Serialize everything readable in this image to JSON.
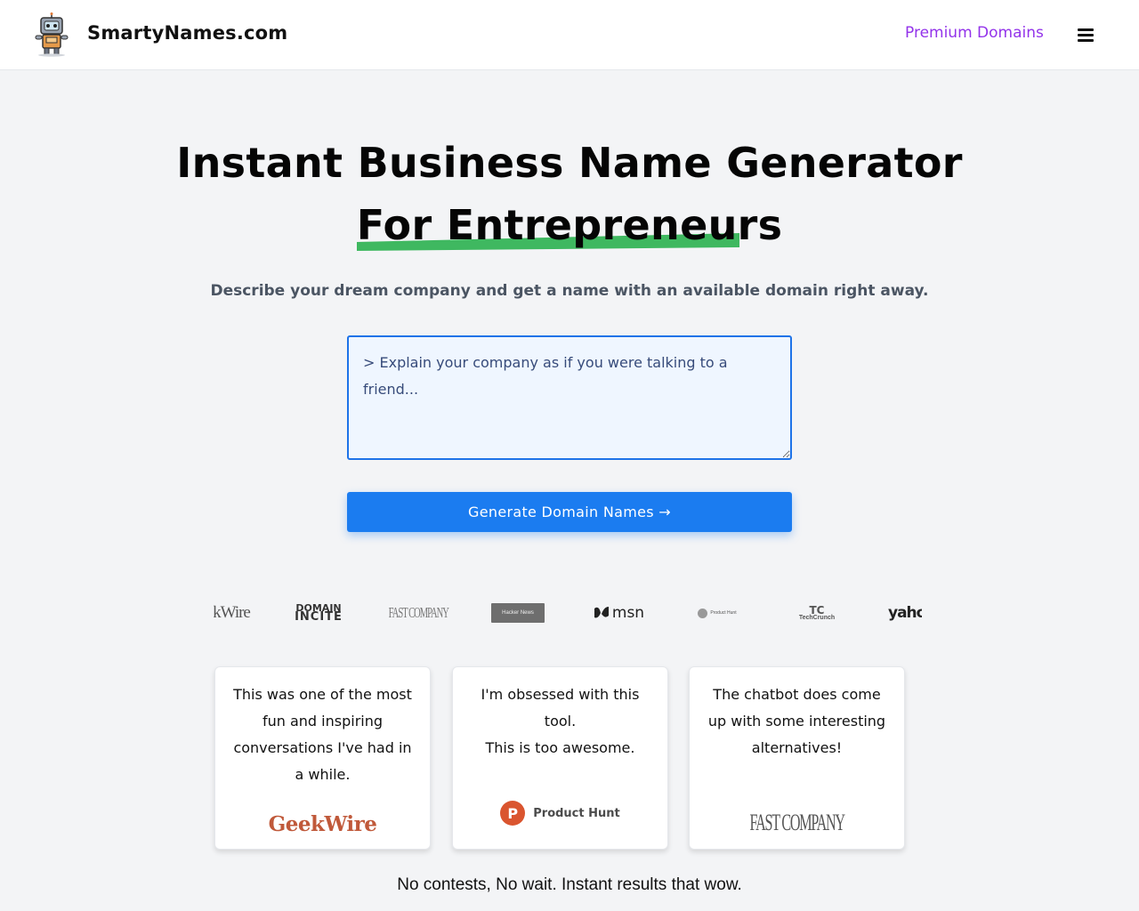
{
  "header": {
    "site_name": "SmartyNames.com",
    "premium_link": "Premium Domains",
    "logo_icon": "robot-mascot-icon",
    "menu_icon": "hamburger-icon"
  },
  "hero": {
    "title_line1": "Instant Business Name Generator",
    "title_line2": "For Entrepreneurs",
    "subtitle": "Describe your dream company and get a name with an available domain right away."
  },
  "prompt": {
    "placeholder": "> Explain your company as if you were talking to a friend...",
    "value": ""
  },
  "generate_button": {
    "label": "Generate Domain Names →"
  },
  "press": {
    "logos": [
      "GeekWire",
      "Domain Incite",
      "Fast Company",
      "Hacker News",
      "msn",
      "Product Hunt",
      "TechCrunch",
      "yahoo"
    ]
  },
  "press_labels": {
    "geekwire_partial": "kWire",
    "domain_incite_top": "DOMAIN",
    "domain_incite_bottom": "INCITE",
    "fastcompany": "FAST COMPANY",
    "hackernews": "Hacker News",
    "msn": "msn",
    "producthunt": "Product Hunt",
    "techcrunch": "TechCrunch",
    "yahoo": "yaho"
  },
  "testimonials": [
    {
      "quote": "This was one of the most fun and inspiring conversations I've had in a while.",
      "source": "GeekWire"
    },
    {
      "quote_line1": "I'm obsessed with this tool.",
      "quote_line2": "This is too awesome.",
      "source": "Product Hunt"
    },
    {
      "quote": "The chatbot does come up with some interesting alternatives!",
      "source": "FAST COMPANY"
    }
  ],
  "tagline": "No contests, No wait. Instant results that wow.",
  "colors": {
    "accent": "#1b7cf0",
    "premium": "#9333ea",
    "highlight": "#3fb860",
    "geekwire": "#c0593a",
    "producthunt": "#da552f"
  }
}
